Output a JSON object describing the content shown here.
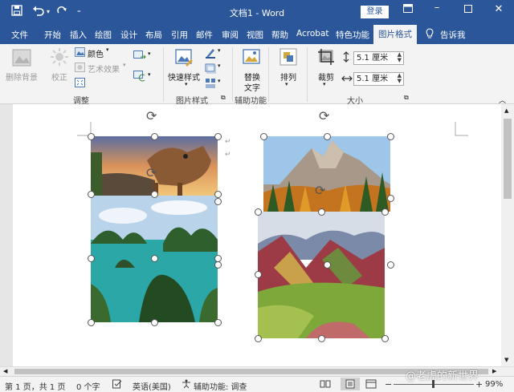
{
  "titlebar": {
    "title": "文档1 - Word",
    "login_label": "登录",
    "save_icon": "save-icon",
    "undo_icon": "undo-icon",
    "redo_icon": "redo-icon",
    "customize_icon": "customize-quick-access-icon"
  },
  "tabs": [
    {
      "label": "文件"
    },
    {
      "label": "开始"
    },
    {
      "label": "插入"
    },
    {
      "label": "绘图"
    },
    {
      "label": "设计"
    },
    {
      "label": "布局"
    },
    {
      "label": "引用"
    },
    {
      "label": "邮件"
    },
    {
      "label": "审阅"
    },
    {
      "label": "视图"
    },
    {
      "label": "帮助"
    },
    {
      "label": "Acrobat"
    },
    {
      "label": "特色功能"
    },
    {
      "label": "图片格式"
    }
  ],
  "tell_me": "告诉我",
  "ribbon": {
    "remove_bg": "删除背景",
    "correct": "校正",
    "color": "颜色",
    "artistic": "艺术效果",
    "adjust_group": "调整",
    "quick_styles": "快速样式",
    "picture_styles_group": "图片样式",
    "replace_text_line1": "替换",
    "replace_text_line2": "文字",
    "accessibility_group": "辅助功能",
    "arrange": "排列",
    "crop": "裁剪",
    "height_value": "5.1 厘米",
    "width_value": "5.1 厘米",
    "size_group": "大小"
  },
  "status": {
    "page": "第 1 页，共 1 页",
    "words": "0 个字",
    "language": "英语(美国)",
    "accessibility": "辅助功能: 调查",
    "zoom": "99%",
    "watermark": "@老虎的新世界"
  },
  "colors": {
    "brand": "#2b579a",
    "ribbon_bg": "#f3f3f3"
  }
}
